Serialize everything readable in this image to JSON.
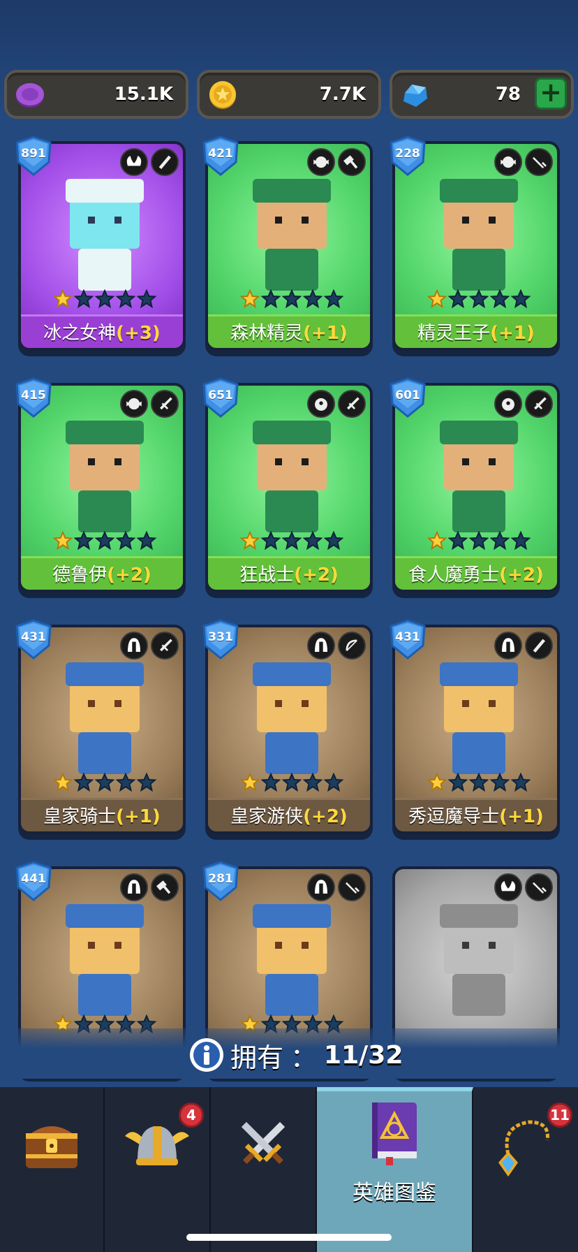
{
  "currency": {
    "potion": {
      "icon": "purple-coin-icon",
      "amount": "15.1K"
    },
    "gold": {
      "icon": "gold-coin-icon",
      "amount": "7.7K"
    },
    "gem": {
      "icon": "gem-icon",
      "amount": "78",
      "plus_label": "+"
    }
  },
  "heroes": [
    {
      "level": "891",
      "name": "冰之女神",
      "bonus": "(+3)",
      "rarity": "purple",
      "role_icon": "wing-emblem-icon",
      "weapon_icon": "wand-icon",
      "stars": 1
    },
    {
      "level": "421",
      "name": "森林精灵",
      "bonus": "(+1)",
      "rarity": "green",
      "role_icon": "elf-emblem-icon",
      "weapon_icon": "hammer-icon",
      "stars": 1
    },
    {
      "level": "228",
      "name": "精灵王子",
      "bonus": "(+1)",
      "rarity": "green",
      "role_icon": "elf-emblem-icon",
      "weapon_icon": "dagger-icon",
      "stars": 1
    },
    {
      "level": "415",
      "name": "德鲁伊",
      "bonus": "(+2)",
      "rarity": "green",
      "role_icon": "elf-emblem-icon",
      "weapon_icon": "sword-icon",
      "stars": 1
    },
    {
      "level": "651",
      "name": "狂战士",
      "bonus": "(+2)",
      "rarity": "green",
      "role_icon": "ogre-emblem-icon",
      "weapon_icon": "sword-icon",
      "stars": 1
    },
    {
      "level": "601",
      "name": "食人魔勇士",
      "bonus": "(+2)",
      "rarity": "green",
      "role_icon": "ogre-emblem-icon",
      "weapon_icon": "sword-icon",
      "stars": 1
    },
    {
      "level": "431",
      "name": "皇家骑士",
      "bonus": "(+1)",
      "rarity": "brown",
      "role_icon": "helmet-emblem-icon",
      "weapon_icon": "sword-icon",
      "stars": 1
    },
    {
      "level": "331",
      "name": "皇家游侠",
      "bonus": "(+2)",
      "rarity": "brown",
      "role_icon": "helmet-emblem-icon",
      "weapon_icon": "bow-icon",
      "stars": 1
    },
    {
      "level": "431",
      "name": "秀逗魔导士",
      "bonus": "(+1)",
      "rarity": "brown",
      "role_icon": "helmet-emblem-icon",
      "weapon_icon": "wand-icon",
      "stars": 1
    },
    {
      "level": "441",
      "name": "",
      "bonus": "",
      "rarity": "brown",
      "role_icon": "helmet-emblem-icon",
      "weapon_icon": "hammer-icon",
      "stars": 1
    },
    {
      "level": "281",
      "name": "",
      "bonus": "",
      "rarity": "brown",
      "role_icon": "helmet-emblem-icon",
      "weapon_icon": "dagger-icon",
      "stars": 1
    },
    {
      "level": "",
      "name": "",
      "bonus": "",
      "rarity": "gray",
      "role_icon": "wing-emblem-icon",
      "weapon_icon": "dagger-icon",
      "stars": 0
    }
  ],
  "owned": {
    "label": "拥有",
    "colon": "：",
    "count": "11/32"
  },
  "tabs": [
    {
      "icon": "treasure-chest-icon",
      "label": "",
      "badge": ""
    },
    {
      "icon": "viking-helmet-icon",
      "label": "",
      "badge": "4"
    },
    {
      "icon": "crossed-swords-icon",
      "label": "",
      "badge": ""
    },
    {
      "icon": "spellbook-icon",
      "label": "英雄图鉴",
      "badge": ""
    },
    {
      "icon": "amulet-icon",
      "label": "",
      "badge": "11"
    }
  ],
  "colors": {
    "background": "#24497f",
    "bonus": "#ffd93a",
    "badge_red": "#d6333d",
    "active_tab": "#6fa7ba"
  }
}
